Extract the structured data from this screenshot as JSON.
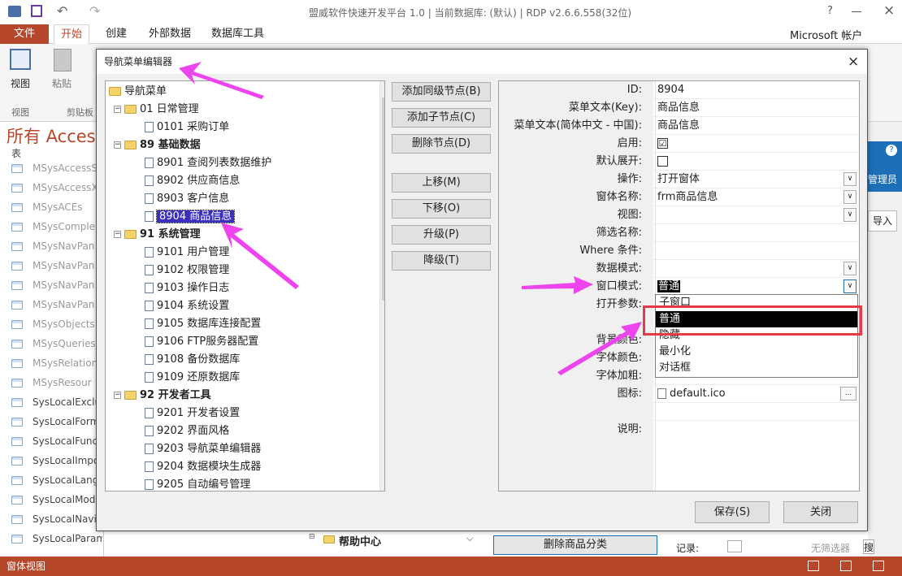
{
  "window": {
    "title": "盟威软件快速开发平台 1.0 | 当前数据库: (默认) | RDP v2.6.6.558(32位)",
    "account": "Microsoft 帐户",
    "help": "?",
    "close": "×"
  },
  "ribbon": {
    "file_tab": "文件",
    "tabs": [
      "开始",
      "创建",
      "外部数据",
      "数据库工具"
    ],
    "groups": {
      "view_label": "视图",
      "view_group": "视图",
      "paste_label": "粘贴",
      "clipboard_group": "剪贴板"
    },
    "right_labels": {
      "admin": "管理员",
      "import": "导入"
    }
  },
  "navpane": {
    "header": "所有 Access",
    "section": "表",
    "items": [
      "MSysAccessS",
      "MSysAccessX",
      "MSysACEs",
      "MSysComple",
      "MSysNavPan",
      "MSysNavPan",
      "MSysNavPan",
      "MSysNavPan",
      "MSysObjects",
      "MSysQueries",
      "MSysRelation",
      "MSysResour",
      "SysLocalExclu",
      "SysLocalForm",
      "SysLocalFunc",
      "SysLocalImpo",
      "SysLocalLang",
      "SysLocalMod",
      "SysLocalNavi",
      "SysLocalParameters"
    ]
  },
  "background": {
    "help_center": "帮助中心",
    "delete_category_button": "删除商品分类",
    "record_label": "记录:",
    "no_filter": "无筛选器",
    "search": "搜"
  },
  "statusbar": {
    "text": "窗体视图"
  },
  "dialog": {
    "title": "导航菜单编辑器",
    "tree": {
      "root": "导航菜单",
      "nodes": [
        {
          "level": 1,
          "type": "folder",
          "label": "01 日常管理",
          "bold": false
        },
        {
          "level": 2,
          "type": "doc",
          "label": "0101 采购订单"
        },
        {
          "level": 1,
          "type": "folder",
          "label": "89 基础数据",
          "bold": true
        },
        {
          "level": 2,
          "type": "doc",
          "label": "8901 查阅列表数据维护"
        },
        {
          "level": 2,
          "type": "doc",
          "label": "8902 供应商信息"
        },
        {
          "level": 2,
          "type": "doc",
          "label": "8903 客户信息"
        },
        {
          "level": 2,
          "type": "doc",
          "label": "8904 商品信息",
          "selected": true
        },
        {
          "level": 1,
          "type": "folder",
          "label": "91 系统管理",
          "bold": true
        },
        {
          "level": 2,
          "type": "doc",
          "label": "9101 用户管理"
        },
        {
          "level": 2,
          "type": "doc",
          "label": "9102 权限管理"
        },
        {
          "level": 2,
          "type": "doc",
          "label": "9103 操作日志"
        },
        {
          "level": 2,
          "type": "doc",
          "label": "9104 系统设置"
        },
        {
          "level": 2,
          "type": "doc",
          "label": "9105 数据库连接配置"
        },
        {
          "level": 2,
          "type": "doc",
          "label": "9106 FTP服务器配置"
        },
        {
          "level": 2,
          "type": "doc",
          "label": "9108 备份数据库"
        },
        {
          "level": 2,
          "type": "doc",
          "label": "9109 还原数据库"
        },
        {
          "level": 1,
          "type": "folder",
          "label": "92 开发者工具",
          "bold": true
        },
        {
          "level": 2,
          "type": "doc",
          "label": "9201 开发者设置"
        },
        {
          "level": 2,
          "type": "doc",
          "label": "9202 界面风格"
        },
        {
          "level": 2,
          "type": "doc",
          "label": "9203 导航菜单编辑器"
        },
        {
          "level": 2,
          "type": "doc",
          "label": "9204 数据模块生成器"
        },
        {
          "level": 2,
          "type": "doc",
          "label": "9205 自动编号管理"
        }
      ]
    },
    "buttons": {
      "add_sibling": "添加同级节点(B)",
      "add_child": "添加子节点(C)",
      "delete_node": "删除节点(D)",
      "move_up": "上移(M)",
      "move_down": "下移(O)",
      "upgrade": "升级(P)",
      "downgrade": "降级(T)",
      "save": "保存(S)",
      "close": "关闭"
    },
    "props": {
      "id": {
        "label": "ID:",
        "value": "8904"
      },
      "key": {
        "label": "菜单文本(Key):",
        "value": "商品信息"
      },
      "zh": {
        "label": "菜单文本(简体中文 - 中国):",
        "value": "商品信息"
      },
      "enabled": {
        "label": "启用:",
        "value": "☑"
      },
      "expand": {
        "label": "默认展开:",
        "value": ""
      },
      "action": {
        "label": "操作:",
        "value": "打开窗体"
      },
      "form": {
        "label": "窗体名称:",
        "value": "frm商品信息"
      },
      "view": {
        "label": "视图:",
        "value": ""
      },
      "filter": {
        "label": "筛选名称:",
        "value": ""
      },
      "where": {
        "label": "Where 条件:",
        "value": ""
      },
      "datamode": {
        "label": "数据模式:",
        "value": ""
      },
      "winmode": {
        "label": "窗口模式:",
        "value": "普通"
      },
      "openargs": {
        "label": "打开参数:",
        "value": ""
      },
      "bgcolor": {
        "label": "背景颜色:",
        "value": ""
      },
      "fontcolor": {
        "label": "字体颜色:",
        "value": ""
      },
      "fontbold": {
        "label": "字体加粗:",
        "value": ""
      },
      "icon": {
        "label": "图标:",
        "value": "default.ico"
      },
      "desc": {
        "label": "说明:",
        "value": ""
      }
    },
    "winmode_options": [
      "子窗口",
      "普通",
      "隐藏",
      "最小化",
      "对话框"
    ]
  },
  "colors": {
    "accent": "#b7472a",
    "highlight": "#000000",
    "selection": "#3a2fbf",
    "annotation": "#ee44ee",
    "annotation_box": "#e8394a"
  }
}
